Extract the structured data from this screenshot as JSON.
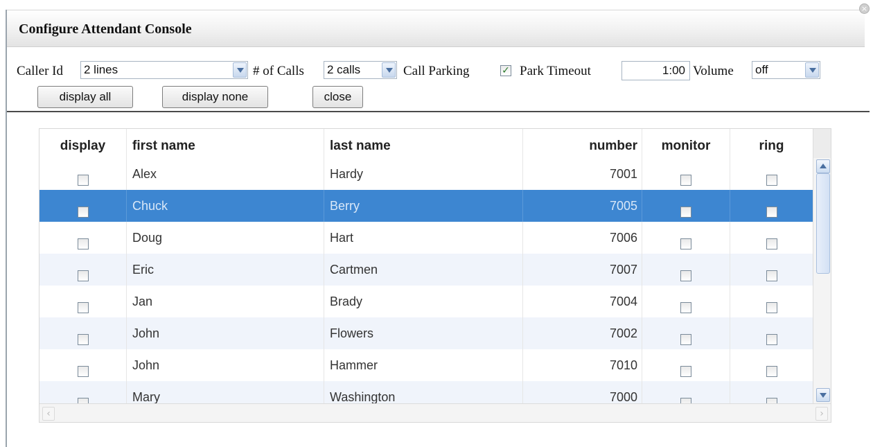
{
  "window": {
    "title": "Configure Attendant Console"
  },
  "controls": {
    "caller_id_label": "Caller Id",
    "caller_id_value": "2 lines",
    "num_calls_label": "# of Calls",
    "num_calls_value": "2 calls",
    "call_parking_label": "Call Parking",
    "call_parking_checked": true,
    "park_timeout_label": "Park Timeout",
    "park_timeout_value": "1:00",
    "volume_label": "Volume",
    "volume_value": "off"
  },
  "buttons": {
    "display_all": "display all",
    "display_none": "display none",
    "close": "close"
  },
  "table": {
    "columns": [
      "display",
      "first name",
      "last name",
      "number",
      "monitor",
      "ring"
    ],
    "rows": [
      {
        "first": "Alex",
        "last": "Hardy",
        "number": "7001"
      },
      {
        "first": "Chuck",
        "last": "Berry",
        "number": "7005",
        "selected": true
      },
      {
        "first": "Doug",
        "last": "Hart",
        "number": "7006"
      },
      {
        "first": "Eric",
        "last": "Cartmen",
        "number": "7007"
      },
      {
        "first": "Jan",
        "last": "Brady",
        "number": "7004"
      },
      {
        "first": "John",
        "last": "Flowers",
        "number": "7002"
      },
      {
        "first": "John",
        "last": "Hammer",
        "number": "7010"
      },
      {
        "first": "Mary",
        "last": "Washington",
        "number": "7000"
      }
    ]
  },
  "colors": {
    "selected_row": "#3d86d1",
    "alt_row": "#f0f4fb"
  }
}
